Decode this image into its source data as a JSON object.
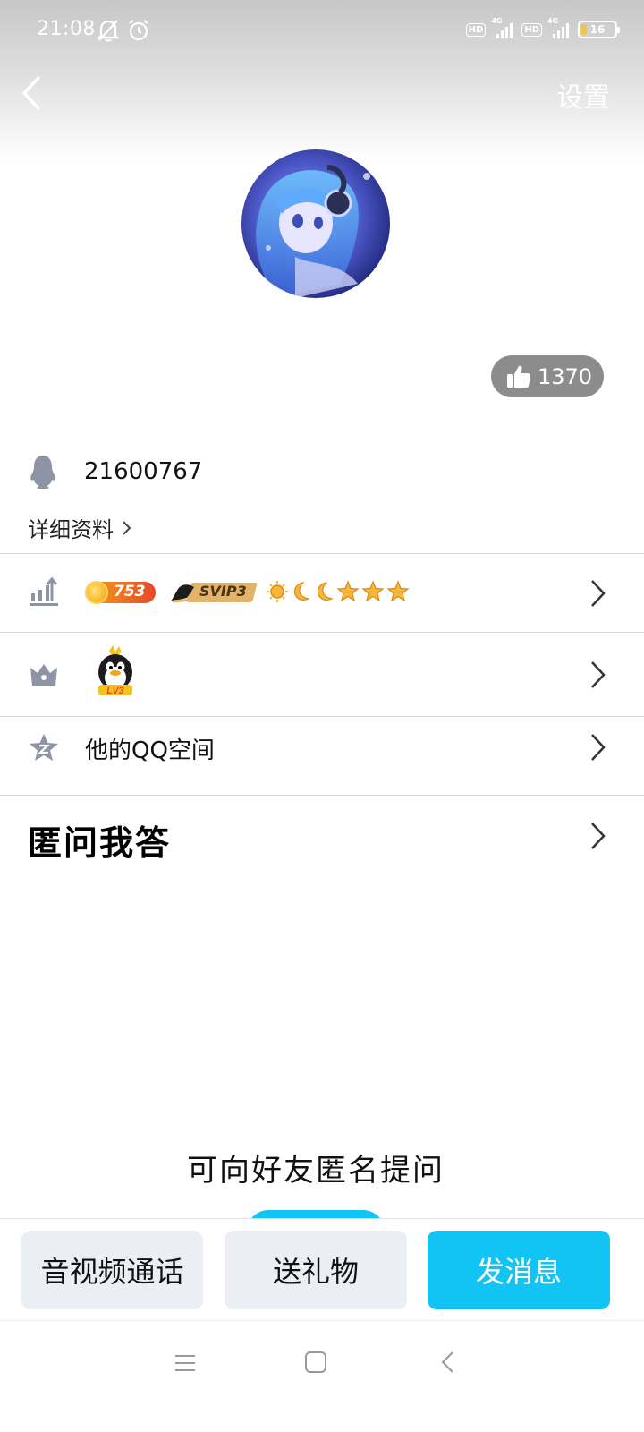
{
  "status_bar": {
    "time": "21:08",
    "hd_label": "HD",
    "network_label": "4G",
    "battery_level": "16",
    "battery_fraction": 0.16,
    "icons": [
      "mute-bell-icon",
      "alarm-icon",
      "signal-icon",
      "battery-icon"
    ]
  },
  "header": {
    "back_icon": "chevron-left-icon",
    "settings_label": "设置"
  },
  "profile": {
    "avatar_icon": "avatar-anime-girl",
    "likes_count": "1370",
    "qq_number": "21600767",
    "detail_link_label": "详细资料"
  },
  "rows": {
    "level": {
      "icon": "level-up-icon",
      "coin_badge": "753",
      "svip_badge": "SVIP3",
      "level_icons": [
        "sun",
        "moon",
        "moon",
        "star",
        "star",
        "star"
      ]
    },
    "vip_mascot": {
      "icon": "crown-icon",
      "mascot_label": "LV3"
    },
    "qzone": {
      "icon": "qzone-star-icon",
      "label": "他的QQ空间"
    }
  },
  "qa_section": {
    "title": "匿问我答",
    "prompt_text": "可向好友匿名提问"
  },
  "action_bar": {
    "call_label": "音视频通话",
    "gift_label": "送礼物",
    "message_label": "发消息"
  },
  "colors": {
    "accent": "#12c4f3",
    "like_pill": "#8c8c8c",
    "secondary_button": "#ebeef5",
    "icon_gray": "#8f93a6"
  }
}
